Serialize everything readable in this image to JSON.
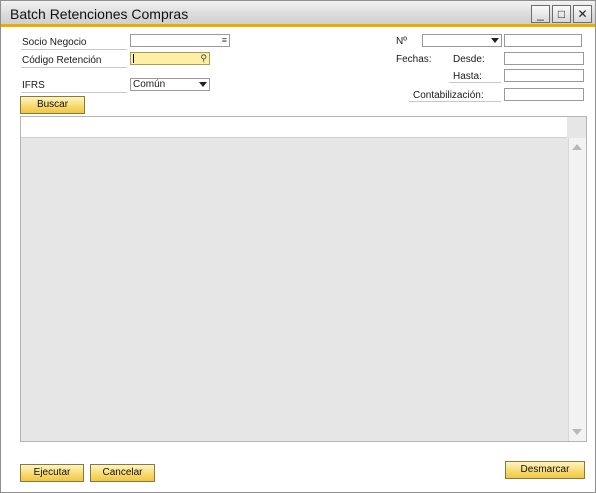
{
  "window": {
    "title": "Batch Retenciones Compras",
    "minimize_glyph": "_",
    "maximize_glyph": "□",
    "close_glyph": "✕"
  },
  "form": {
    "socio_negocio": {
      "label": "Socio Negocio",
      "value": "",
      "icon": "list-icon",
      "icon_glyph": "≡"
    },
    "codigo_retencion": {
      "label": "Código Retención",
      "value": "",
      "icon": "search-icon",
      "icon_glyph": "⚲"
    },
    "ifrs": {
      "label": "IFRS",
      "selected": "Común"
    },
    "buscar_label": "Buscar",
    "numero": {
      "label": "Nº",
      "selected": "",
      "value": ""
    },
    "fechas_label": "Fechas:",
    "desde": {
      "label": "Desde:",
      "value": ""
    },
    "hasta": {
      "label": "Hasta:",
      "value": ""
    },
    "contabilizacion": {
      "label": "Contabilización:",
      "value": ""
    }
  },
  "footer": {
    "ejecutar_label": "Ejecutar",
    "cancelar_label": "Cancelar",
    "desmarcar_label": "Desmarcar"
  },
  "colors": {
    "accent": "#f0ab00",
    "button_fill": "#f7d86a",
    "active_field": "#fdf0a4",
    "grid_bg": "#e6e6e6"
  }
}
